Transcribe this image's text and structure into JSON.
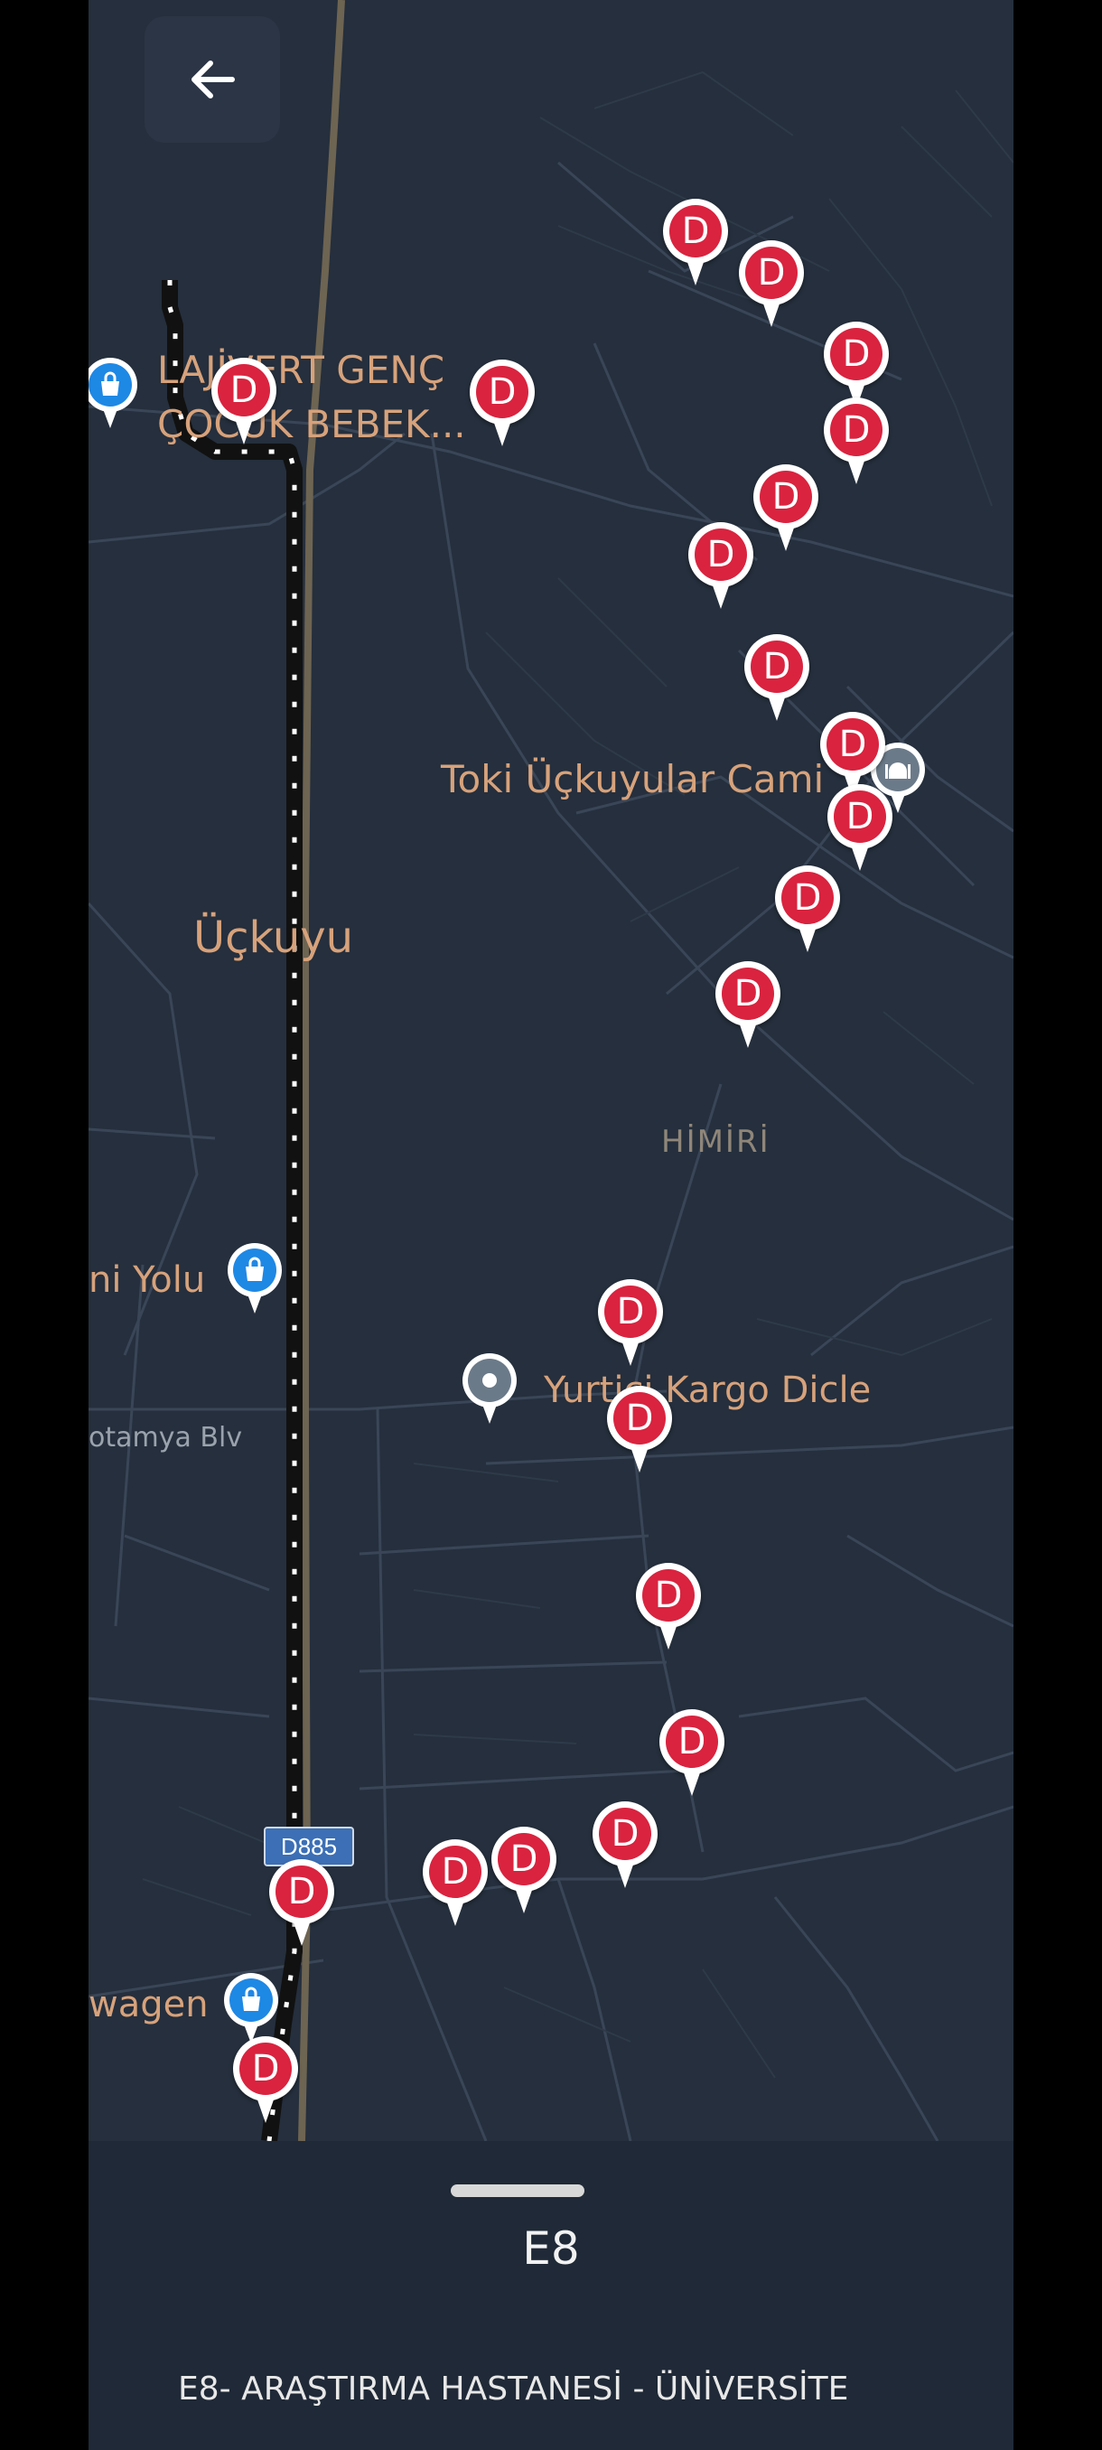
{
  "colors": {
    "map_bg": "#252f3d",
    "road": "#3a4657",
    "highway": "#6e6452",
    "label": "#d7a27b",
    "stop_red": "#d9233f",
    "shop_blue": "#1e88e5",
    "place_grey": "#6b7a89",
    "sheet_bg": "#1f2937"
  },
  "map": {
    "back_icon": "arrow-left-icon",
    "stop_marker_letter": "D",
    "stop_count": 24,
    "road_shield": "D885",
    "labels": {
      "lajivert_line1": "LAJİVERT GENÇ",
      "lajivert_line2": "ÇOCUK BEBEK...",
      "toki_mosque": "Toki Üçkuyular Cami",
      "district": "Üçkuyu",
      "neighborhood": "HİMİRİ",
      "yolu": "ni Yolu",
      "kargo": "Yurtiçi Kargo Dicle",
      "boulevard": "otamya Blv",
      "wagen": "wagen"
    },
    "icons": {
      "shop": "shopping-bag-icon",
      "mosque": "mosque-icon",
      "place": "place-dot-icon"
    }
  },
  "sheet": {
    "route_code": "E8",
    "route_name": "E8- ARAŞTIRMA HASTANESİ - ÜNİVERSİTE"
  }
}
